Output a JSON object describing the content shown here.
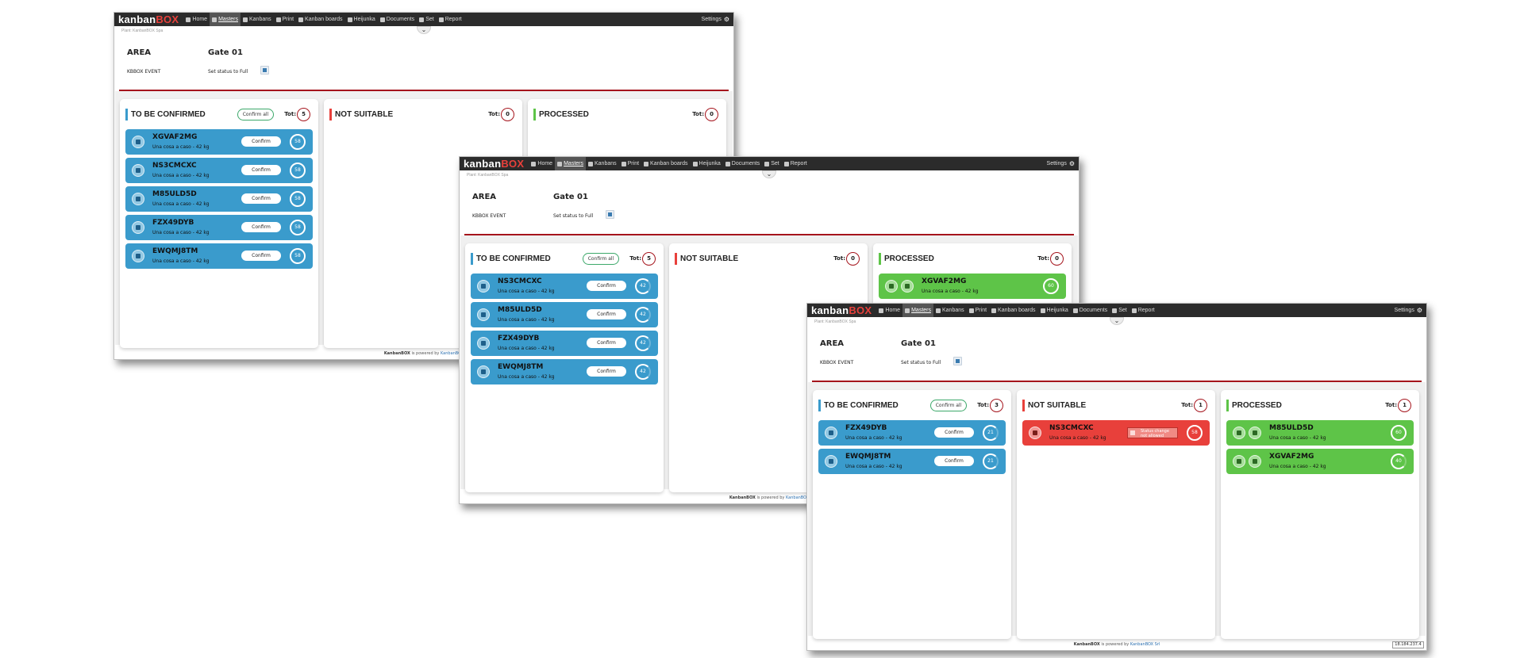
{
  "app": {
    "logo_kanban": "kanban",
    "logo_box": "BOX",
    "nav": [
      {
        "label": "Home",
        "icon": "home-icon",
        "active": false
      },
      {
        "label": "Masters",
        "icon": "masters-icon",
        "active": true
      },
      {
        "label": "Kanbans",
        "icon": "kanbans-icon",
        "active": false
      },
      {
        "label": "Print",
        "icon": "print-icon",
        "active": false
      },
      {
        "label": "Kanban boards",
        "icon": "kanban-boards-icon",
        "active": false
      },
      {
        "label": "Heijunka",
        "icon": "heijunka-icon",
        "active": false
      },
      {
        "label": "Documents",
        "icon": "documents-icon",
        "active": false
      },
      {
        "label": "Set",
        "icon": "set-icon",
        "active": false
      },
      {
        "label": "Report",
        "icon": "report-icon",
        "active": false
      }
    ],
    "settings": "Settings",
    "toggle": "⌄",
    "plant": "Plant: KanbanBOX Spa",
    "area_label": "AREA",
    "area_value": "Gate 01",
    "event_label": "KBBOX EVENT",
    "event_value": "Set status to Full",
    "col_titles": {
      "tbc": "TO BE CONFIRMED",
      "ns": "NOT SUITABLE",
      "proc": "PROCESSED"
    },
    "confirm_all": "Confirm all",
    "tot_label": "Tot:",
    "confirm": "Confirm",
    "footer_brand": "KanbanBOX",
    "footer_text": " is powered by ",
    "colors": {
      "blue": "#3a9bcc",
      "red": "#e8403b",
      "green": "#5ec448",
      "nav": "#2b2b2b",
      "divider": "#a5141c"
    }
  },
  "screens": [
    {
      "footer_link": "KanbanBOX",
      "ip": "",
      "tbc": {
        "tot": "5",
        "cards": [
          {
            "code": "XGVAF2MG",
            "sub": "Una cosa a caso - 42 kg",
            "ring": "58",
            "level": 1
          },
          {
            "code": "NS3CMCXC",
            "sub": "Una cosa a caso - 42 kg",
            "ring": "58",
            "level": 1
          },
          {
            "code": "M85ULD5D",
            "sub": "Una cosa a caso - 42 kg",
            "ring": "58",
            "level": 1
          },
          {
            "code": "FZX49DYB",
            "sub": "Una cosa a caso - 42 kg",
            "ring": "58",
            "level": 1
          },
          {
            "code": "EWQMJ8TM",
            "sub": "Una cosa a caso - 42 kg",
            "ring": "58",
            "level": 1
          }
        ]
      },
      "ns": {
        "tot": "0",
        "cards": []
      },
      "proc": {
        "tot": "0",
        "cards": []
      }
    },
    {
      "footer_link": "KanbanBOX",
      "ip": "",
      "tbc": {
        "tot": "5",
        "cards": [
          {
            "code": "NS3CMCXC",
            "sub": "Una cosa a caso - 42 kg",
            "ring": "42",
            "level": 0.7
          },
          {
            "code": "M85ULD5D",
            "sub": "Una cosa a caso - 42 kg",
            "ring": "42",
            "level": 0.7
          },
          {
            "code": "FZX49DYB",
            "sub": "Una cosa a caso - 42 kg",
            "ring": "42",
            "level": 0.7
          },
          {
            "code": "EWQMJ8TM",
            "sub": "Una cosa a caso - 42 kg",
            "ring": "42",
            "level": 0.7
          }
        ]
      },
      "ns": {
        "tot": "0",
        "cards": []
      },
      "proc": {
        "tot": "0",
        "cards": [
          {
            "code": "XGVAF2MG",
            "sub": "Una cosa a caso - 42 kg",
            "ring": "60",
            "level": 1
          }
        ]
      }
    },
    {
      "footer_link": "KanbanBOX Srl",
      "ip": "18.184.237.4",
      "tbc": {
        "tot": "3",
        "cards": [
          {
            "code": "FZX49DYB",
            "sub": "Una cosa a caso - 42 kg",
            "ring": "21",
            "level": 0.35
          },
          {
            "code": "EWQMJ8TM",
            "sub": "Una cosa a caso - 42 kg",
            "ring": "21",
            "level": 0.35
          }
        ]
      },
      "ns": {
        "tot": "1",
        "cards": [
          {
            "code": "NS3CMCXC",
            "sub": "Una cosa a caso - 42 kg",
            "ring": "58",
            "level": 1,
            "warning": "Status change not allowed"
          }
        ]
      },
      "proc": {
        "tot": "1",
        "cards": [
          {
            "code": "M85ULD5D",
            "sub": "Una cosa a caso - 42 kg",
            "ring": "60",
            "level": 1
          },
          {
            "code": "XGVAF2MG",
            "sub": "Una cosa a caso - 42 kg",
            "ring": "40",
            "level": 0.67
          }
        ]
      }
    }
  ]
}
